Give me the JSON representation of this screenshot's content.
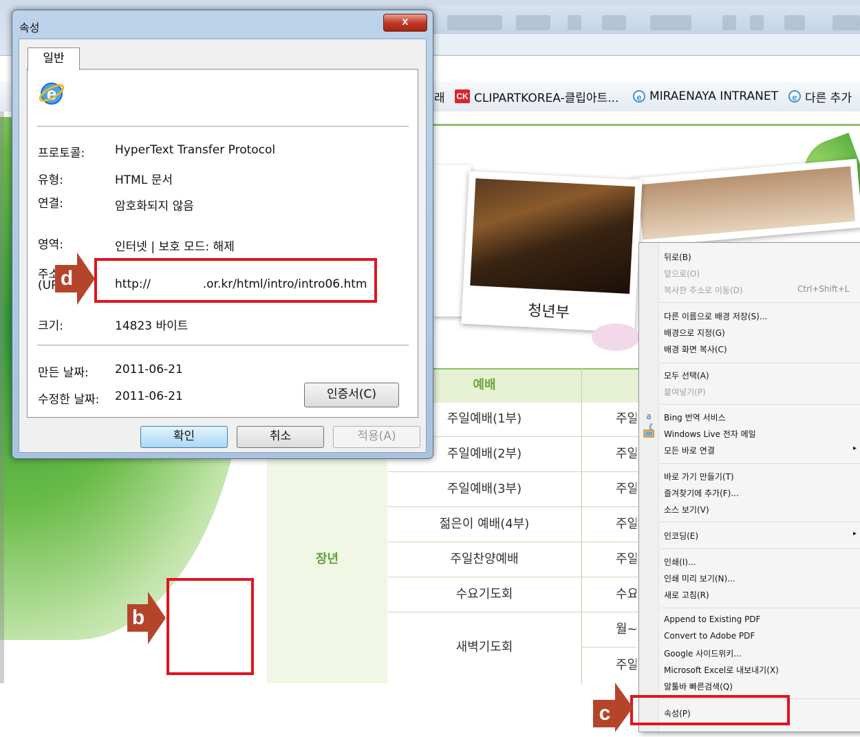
{
  "favorites_bar": {
    "item_partial": "래",
    "item1_label": "CLIPARTKOREA-클립아트...",
    "item1_logo": "CK",
    "item2_label": "MIRAENAYA INTRANET",
    "item3_label": "다른 추가",
    "ie_glyph": "e"
  },
  "page": {
    "photo_caption": "청년부",
    "schedule": {
      "header": "예배",
      "group_label": "장년",
      "rows": [
        {
          "service": "주일예배(1부)",
          "time": "주일"
        },
        {
          "service": "주일예배(2부)",
          "time": "주일"
        },
        {
          "service": "주일예배(3부)",
          "time": "주일"
        },
        {
          "service": "젊은이 예배(4부)",
          "time": "주일"
        },
        {
          "service": "주일찬양예배",
          "time": "주일"
        },
        {
          "service": "수요기도회",
          "time": "수요"
        },
        {
          "service": "새벽기도회",
          "time": "월~"
        },
        {
          "service": "",
          "time": "주일"
        }
      ]
    }
  },
  "context_menu": {
    "items": [
      {
        "label": "뒤로(B)",
        "disabled": false
      },
      {
        "label": "앞으로(O)",
        "disabled": true
      },
      {
        "label": "복사한 주소로 이동(D)",
        "disabled": true,
        "shortcut": "Ctrl+Shift+L"
      },
      {
        "label": "다른 이름으로 배경 저장(S)...",
        "disabled": false
      },
      {
        "label": "배경으로 지정(G)",
        "disabled": false
      },
      {
        "label": "배경 화면 복사(C)",
        "disabled": false
      },
      {
        "label": "모두 선택(A)",
        "disabled": false
      },
      {
        "label": "붙여넣기(P)",
        "disabled": true
      },
      {
        "label": "Bing 번역 서비스",
        "disabled": false,
        "icon": "bing-translate-icon"
      },
      {
        "label": "Windows Live 전자 메일",
        "disabled": false,
        "icon": "windows-live-mail-icon"
      },
      {
        "label": "모든 바로 연결",
        "disabled": false,
        "submenu": true
      },
      {
        "label": "바로 가기 만들기(T)",
        "disabled": false
      },
      {
        "label": "즐겨찾기에 추가(F)...",
        "disabled": false
      },
      {
        "label": "소스 보기(V)",
        "disabled": false
      },
      {
        "label": "인코딩(E)",
        "disabled": false,
        "submenu": true
      },
      {
        "label": "인쇄(I)...",
        "disabled": false
      },
      {
        "label": "인쇄 미리 보기(N)...",
        "disabled": false
      },
      {
        "label": "새로 고침(R)",
        "disabled": false
      },
      {
        "label": "Append to Existing PDF",
        "disabled": false
      },
      {
        "label": "Convert to Adobe PDF",
        "disabled": false
      },
      {
        "label": "Google 사이드위키...",
        "disabled": false
      },
      {
        "label": "Microsoft Excel로 내보내기(X)",
        "disabled": false
      },
      {
        "label": "알툴바 빠른검색(Q)",
        "disabled": false
      },
      {
        "label": "속성(P)",
        "disabled": false
      }
    ],
    "submenu_arrow": "▸"
  },
  "dialog": {
    "title": "속성",
    "close_glyph": "x",
    "tab": "일반",
    "ie_glyph": "e",
    "labels": {
      "protocol": "프로토콜:",
      "type": "유형:",
      "connection": "연결:",
      "zone": "영역:",
      "address_line1": "주소:",
      "address_line2": "(URL)",
      "size": "크기:",
      "created": "만든 날짜:",
      "modified": "수정한 날짜:"
    },
    "values": {
      "protocol": "HyperText Transfer Protocol",
      "type": "HTML 문서",
      "connection": "암호화되지 않음",
      "zone": "인터넷 | 보호 모드: 해제",
      "address": "http://              .or.kr/html/intro/intro06.htm",
      "size": "14823 바이트",
      "created": "2011-06-21",
      "modified": "2011-06-21"
    },
    "buttons": {
      "certificate": "인증서(C)",
      "ok": "확인",
      "cancel": "취소",
      "apply": "적용(A)"
    }
  },
  "annotations": {
    "b": "b",
    "c": "c",
    "d": "d",
    "marker_color": "#b4452b",
    "box_color": "#e0141e"
  }
}
